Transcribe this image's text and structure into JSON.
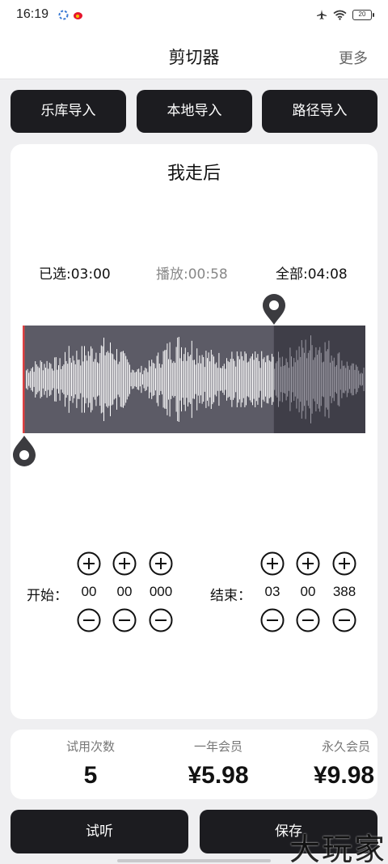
{
  "status_bar": {
    "time": "16:19",
    "battery": "20",
    "icons": [
      "app-notification-icon",
      "weibo-icon",
      "airplane-icon",
      "wifi-icon",
      "battery-icon"
    ]
  },
  "nav": {
    "title": "剪切器",
    "more": "更多"
  },
  "import_buttons": [
    {
      "label": "乐库导入"
    },
    {
      "label": "本地导入"
    },
    {
      "label": "路径导入"
    }
  ],
  "player": {
    "song_title": "我走后",
    "selected": "已选:03:00",
    "playing": "播放:00:58",
    "total": "全部:04:08",
    "playhead_fraction": 0.733,
    "start_marker_fraction": 0.0
  },
  "start": {
    "label": "开始：",
    "values": [
      "00",
      "00",
      "000"
    ]
  },
  "end": {
    "label": "结束：",
    "values": [
      "03",
      "00",
      "388"
    ]
  },
  "plans": [
    {
      "label": "试用次数",
      "value": "5"
    },
    {
      "label": "一年会员",
      "value": "¥5.98"
    },
    {
      "label": "永久会员",
      "value": "¥9.98"
    }
  ],
  "bottom": {
    "listen": "试听",
    "save": "保存"
  },
  "watermark": "大玩家",
  "colors": {
    "button_bg": "#1c1c20",
    "waveform_bg": "#5c5b66",
    "waveform_unplayed": "#3f3e48",
    "start_line": "#e04040"
  }
}
